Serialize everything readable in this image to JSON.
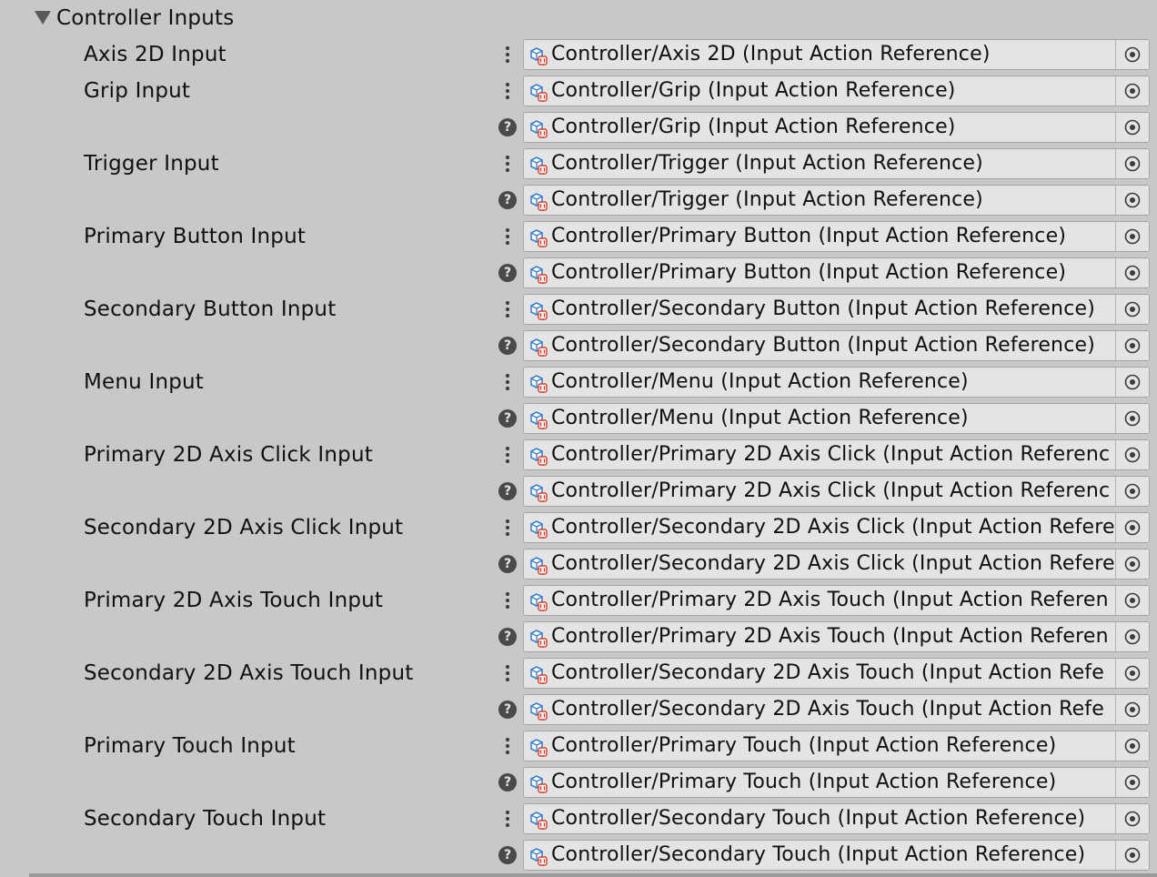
{
  "section": {
    "title": "Controller Inputs",
    "expanded": true
  },
  "rows": [
    {
      "label": "Axis 2D Input",
      "control": "menu",
      "value": "Controller/Axis 2D (Input Action Reference)"
    },
    {
      "label": "Grip Input",
      "control": "menu",
      "value": "Controller/Grip (Input Action Reference)"
    },
    {
      "label": "",
      "control": "help",
      "value": "Controller/Grip (Input Action Reference)"
    },
    {
      "label": "Trigger Input",
      "control": "menu",
      "value": "Controller/Trigger (Input Action Reference)"
    },
    {
      "label": "",
      "control": "help",
      "value": "Controller/Trigger (Input Action Reference)"
    },
    {
      "label": "Primary Button Input",
      "control": "menu",
      "value": "Controller/Primary Button (Input Action Reference)"
    },
    {
      "label": "",
      "control": "help",
      "value": "Controller/Primary Button (Input Action Reference)"
    },
    {
      "label": "Secondary Button Input",
      "control": "menu",
      "value": "Controller/Secondary Button (Input Action Reference)"
    },
    {
      "label": "",
      "control": "help",
      "value": "Controller/Secondary Button (Input Action Reference)"
    },
    {
      "label": "Menu Input",
      "control": "menu",
      "value": "Controller/Menu (Input Action Reference)"
    },
    {
      "label": "",
      "control": "help",
      "value": "Controller/Menu (Input Action Reference)"
    },
    {
      "label": "Primary 2D Axis Click Input",
      "control": "menu",
      "value": "Controller/Primary 2D Axis Click (Input Action Referenc"
    },
    {
      "label": "",
      "control": "help",
      "value": "Controller/Primary 2D Axis Click (Input Action Referenc"
    },
    {
      "label": "Secondary 2D Axis Click Input",
      "control": "menu",
      "value": "Controller/Secondary 2D Axis Click (Input Action Refere"
    },
    {
      "label": "",
      "control": "help",
      "value": "Controller/Secondary 2D Axis Click (Input Action Refere"
    },
    {
      "label": "Primary 2D Axis Touch Input",
      "control": "menu",
      "value": "Controller/Primary 2D Axis Touch (Input Action Referen"
    },
    {
      "label": "",
      "control": "help",
      "value": "Controller/Primary 2D Axis Touch (Input Action Referen"
    },
    {
      "label": "Secondary 2D Axis Touch Input",
      "control": "menu",
      "value": "Controller/Secondary 2D Axis Touch (Input Action Refe"
    },
    {
      "label": "",
      "control": "help",
      "value": "Controller/Secondary 2D Axis Touch (Input Action Refe"
    },
    {
      "label": "Primary Touch Input",
      "control": "menu",
      "value": "Controller/Primary Touch (Input Action Reference)"
    },
    {
      "label": "",
      "control": "help",
      "value": "Controller/Primary Touch (Input Action Reference)"
    },
    {
      "label": "Secondary Touch Input",
      "control": "menu",
      "value": "Controller/Secondary Touch (Input Action Reference)"
    },
    {
      "label": "",
      "control": "help",
      "value": "Controller/Secondary Touch (Input Action Reference)"
    }
  ],
  "icons": {
    "foldout": "triangle-down-icon",
    "menu": "kebab-menu-icon",
    "help": "help-icon",
    "asset": "input-action-asset-icon",
    "picker": "object-picker-icon"
  },
  "colors": {
    "background": "#c8c8c8",
    "field": "#e4e4e4",
    "asset_icon_blue": "#3b7fd1",
    "asset_icon_red": "#d23a2a"
  }
}
